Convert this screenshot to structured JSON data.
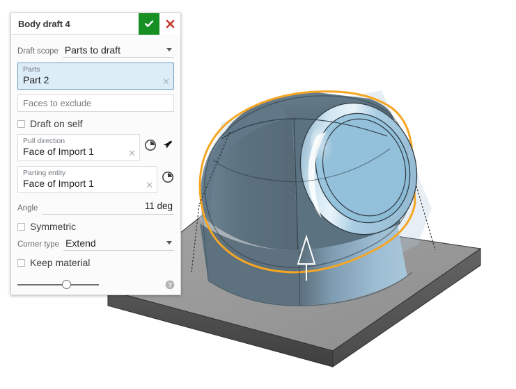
{
  "dialog": {
    "title": "Body draft 4",
    "accept_label": "✓",
    "cancel_label": "✕",
    "accept_color": "#188f23",
    "cancel_color": "#c0392b",
    "draft_scope": {
      "label": "Draft scope",
      "value": "Parts to draft"
    },
    "parts": {
      "label": "Parts",
      "value": "Part 2",
      "clear": "✕"
    },
    "faces_to_exclude": {
      "placeholder": "Faces to exclude"
    },
    "draft_on_self": {
      "label": "Draft on self",
      "checked": false
    },
    "pull_direction": {
      "label": "Pull direction",
      "value": "Face of Import 1",
      "clear": "✕"
    },
    "parting_entity": {
      "label": "Parting entity",
      "value": "Face of Import 1",
      "clear": "✕"
    },
    "angle": {
      "label": "Angle",
      "value": "11 deg"
    },
    "symmetric": {
      "label": "Symmetric",
      "checked": false
    },
    "corner_type": {
      "label": "Corner type",
      "value": "Extend"
    },
    "keep_material": {
      "label": "Keep material",
      "checked": false
    },
    "footer": {
      "slider_position_pct": 62,
      "help_label": "?"
    },
    "icons": {
      "flip_pull_direction": "flip-direction-icon",
      "pick_direction": "arrow-pointer-icon",
      "flip_parting_entity": "flip-direction-icon",
      "dropdown_caret": "chevron-down-icon",
      "help": "help-icon"
    }
  },
  "viewport": {
    "model_name": "Body draft 4 preview",
    "colors": {
      "base_plate_top": "#9a9a9a",
      "base_plate_side": "#4d4d4d",
      "body_dark": "#5c7280",
      "body_light": "#a8c8dd",
      "highlight_edge": "#f5a623",
      "preview_ghost": "#b6cddd",
      "direction_arrow": "#ffffff"
    },
    "annotations": {
      "highlight_edge_name": "selected-draft-edge",
      "direction_arrow_name": "pull-direction-arrow",
      "ghost_preview_name": "draft-preview-ghost"
    }
  }
}
